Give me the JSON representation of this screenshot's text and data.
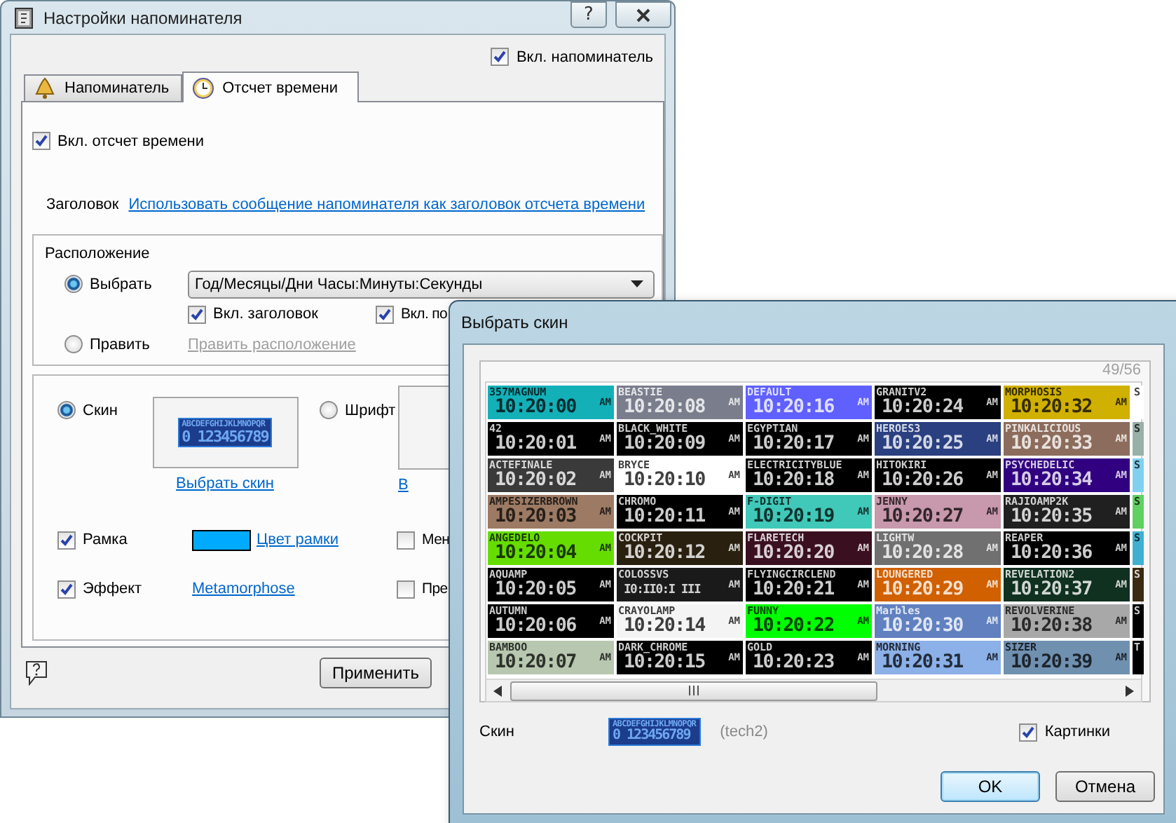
{
  "settings_window": {
    "title": "Настройки напоминателя",
    "help_button": "?",
    "enable_reminder": {
      "label": "Вкл. напоминатель",
      "checked": true
    },
    "tabs": [
      {
        "label": "Напоминатель",
        "selected": false
      },
      {
        "label": "Отсчет времени",
        "selected": true
      }
    ],
    "enable_countdown": {
      "label": "Вкл. отсчет времени",
      "checked": true
    },
    "heading": {
      "label": "Заголовок",
      "link": "Использовать сообщение напоминателя как заголовок отсчета времени"
    },
    "placement": {
      "title": "Расположение",
      "options": [
        {
          "label": "Выбрать",
          "selected": true
        },
        {
          "label": "Править",
          "selected": false
        }
      ],
      "dropdown": "Год/Месяцы/Дни Часы:Минуты:Секунды",
      "checkboxes": [
        {
          "label": "Вкл. заголовок",
          "checked": true
        },
        {
          "label": "Вкл. по",
          "checked": true
        }
      ],
      "edit_link": {
        "label": "Править расположение",
        "disabled": true
      }
    },
    "appearance": {
      "options": [
        {
          "label": "Скин",
          "selected": true
        },
        {
          "label": "Шрифт",
          "selected": false
        }
      ],
      "skin_preview": {
        "letters": "ABCDEFGHIJKLMNOPQR",
        "digits": "0 123456789"
      },
      "choose_skin_link": "Выбрать скин",
      "font_link": "В",
      "frame": {
        "label": "Рамка",
        "checked": true
      },
      "frame_color": {
        "color": "#00aaff",
        "link": "Цвет рамки"
      },
      "effect": {
        "label": "Эффект",
        "checked": true
      },
      "effect_link": "Metamorphose",
      "right_checkboxes": [
        {
          "label": "Мен",
          "checked": false
        },
        {
          "label": "Пре",
          "checked": false
        }
      ]
    },
    "apply_button": "Применить"
  },
  "skin_dialog": {
    "title": "Выбрать скин",
    "counter": "49/56",
    "skins": [
      {
        "kind": "full",
        "name": "357MAGNUM",
        "time": "10:20:00",
        "ampm": "AM",
        "color": "#14b0b8"
      },
      {
        "kind": "full",
        "name": "42",
        "time": "10:20:01",
        "ampm": "AM",
        "color": "#000000"
      },
      {
        "kind": "full",
        "name": "ACTEFINALE",
        "time": "10:20:02",
        "ampm": "AM",
        "color": "#3a3a3a"
      },
      {
        "kind": "full",
        "name": "AMPESIZERBROWN",
        "time": "10:20:03",
        "ampm": "AM",
        "color": "#9c7a64"
      },
      {
        "kind": "full",
        "name": "ANGEDELO",
        "time": "10:20:04",
        "ampm": "AM",
        "color": "#66dd00"
      },
      {
        "kind": "full",
        "name": "AQUAMP",
        "time": "10:20:05",
        "ampm": "AM",
        "color": "#000000"
      },
      {
        "kind": "full",
        "name": "AUTUMN",
        "time": "10:20:06",
        "ampm": "AM",
        "color": "#000000"
      },
      {
        "kind": "full",
        "name": "BAMBOO",
        "time": "10:20:07",
        "ampm": "AM",
        "color": "#b8c8b0"
      },
      {
        "kind": "full",
        "name": "BEASTIE",
        "time": "10:20:08",
        "ampm": "AM",
        "color": "#7a7d8c"
      },
      {
        "kind": "full",
        "name": "BLACK_WHITE",
        "time": "10:20:09",
        "ampm": "AM",
        "color": "#000000"
      },
      {
        "kind": "full",
        "name": "BRYCE",
        "time": "10:20:10",
        "ampm": "AM",
        "color": "#ffffff"
      },
      {
        "kind": "full",
        "name": "CHROMO",
        "time": "10:20:11",
        "ampm": "AM",
        "color": "#000000"
      },
      {
        "kind": "full",
        "name": "COCKPIT",
        "time": "10:20:12",
        "ampm": "AM",
        "color": "#2a2010"
      },
      {
        "kind": "full",
        "name": "COLOSSVS",
        "time": "I0:II0:I III",
        "ampm": "AM",
        "color": "#1a1a1a"
      },
      {
        "kind": "full",
        "name": "CRAYOLAMP",
        "time": "10:20:14",
        "ampm": "AM",
        "color": "#f4f4f4"
      },
      {
        "kind": "full",
        "name": "DARK_CHROME",
        "time": "10:20:15",
        "ampm": "AM",
        "color": "#000000"
      },
      {
        "kind": "full",
        "name": "DEFAULT",
        "time": "10:20:16",
        "ampm": "AM",
        "color": "#6060ff"
      },
      {
        "kind": "full",
        "name": "EGYPTIAN",
        "time": "10:20:17",
        "ampm": "AM",
        "color": "#000000"
      },
      {
        "kind": "full",
        "name": "ELECTRICITYBLUE",
        "time": "10:20:18",
        "ampm": "AM",
        "color": "#000000"
      },
      {
        "kind": "full",
        "name": "F-DIGIT",
        "time": "10:20:19",
        "ampm": "AM",
        "color": "#40c8b8"
      },
      {
        "kind": "full",
        "name": "FLARETECH",
        "time": "10:20:20",
        "ampm": "AM",
        "color": "#3a1020"
      },
      {
        "kind": "full",
        "name": "FLYINGCIRCLEND",
        "time": "10:20:21",
        "ampm": "AM",
        "color": "#000000"
      },
      {
        "kind": "full",
        "name": "FUNNY",
        "time": "10:20:22",
        "ampm": "AM",
        "color": "#00ff00"
      },
      {
        "kind": "full",
        "name": "GOLD",
        "time": "10:20:23",
        "ampm": "AM",
        "color": "#000000"
      },
      {
        "kind": "full",
        "name": "GRANITV2",
        "time": "10:20:24",
        "ampm": "AM",
        "color": "#000000"
      },
      {
        "kind": "full",
        "name": "HEROES3",
        "time": "10:20:25",
        "ampm": "AM",
        "color": "#2a4080"
      },
      {
        "kind": "full",
        "name": "HITOKIRI",
        "time": "10:20:26",
        "ampm": "AM",
        "color": "#000000"
      },
      {
        "kind": "full",
        "name": "JENNY",
        "time": "10:20:27",
        "ampm": "AM",
        "color": "#c898ac"
      },
      {
        "kind": "full",
        "name": "LIGHTW",
        "time": "10:20:28",
        "ampm": "AM",
        "color": "#707070"
      },
      {
        "kind": "full",
        "name": "LOUNGERED",
        "time": "10:20:29",
        "ampm": "AM",
        "color": "#d06000"
      },
      {
        "kind": "full",
        "name": "Marbles",
        "time": "10:20:30",
        "ampm": "AM",
        "color": "#6080c0"
      },
      {
        "kind": "full",
        "name": "MORNING",
        "time": "10:20:31",
        "ampm": "AM",
        "color": "#8cb0e8"
      },
      {
        "kind": "full",
        "name": "MORPHOSIS",
        "time": "10:20:32",
        "ampm": "AM",
        "color": "#d0b000"
      },
      {
        "kind": "full",
        "name": "PINKALICIOUS",
        "time": "10:20:33",
        "ampm": "AM",
        "color": "#8c6c5c"
      },
      {
        "kind": "full",
        "name": "PSYCHEDELIC",
        "time": "10:20:34",
        "ampm": "AM",
        "color": "#300080"
      },
      {
        "kind": "full",
        "name": "RAJIOAMP2K",
        "time": "10:20:35",
        "ampm": "AM",
        "color": "#202020"
      },
      {
        "kind": "full",
        "name": "REAPER",
        "time": "10:20:36",
        "ampm": "AM",
        "color": "#000000"
      },
      {
        "kind": "full",
        "name": "REVELATION2",
        "time": "10:20:37",
        "ampm": "AM",
        "color": "#103020"
      },
      {
        "kind": "full",
        "name": "REVOLVERINE",
        "time": "10:20:38",
        "ampm": "AM",
        "color": "#a8a8a8"
      },
      {
        "kind": "full",
        "name": "SIZER",
        "time": "10:20:39",
        "ampm": "AM",
        "color": "#7090b0"
      },
      {
        "kind": "cut",
        "name": "S",
        "color": "#ffffff"
      },
      {
        "kind": "cut",
        "name": "S",
        "color": "#98b0a8"
      },
      {
        "kind": "cut",
        "name": "S",
        "color": "#80d0f0"
      },
      {
        "kind": "cut",
        "name": "S",
        "color": "#60d060"
      },
      {
        "kind": "cut",
        "name": "S",
        "color": "#40b0d0"
      },
      {
        "kind": "cut",
        "name": "S",
        "color": "#3a2a10"
      },
      {
        "kind": "cut",
        "name": "S",
        "color": "#000000"
      },
      {
        "kind": "cut",
        "name": "T",
        "color": "#000000"
      }
    ],
    "skin_label": "Скин",
    "preview": {
      "letters": "ABCDEFGHIJKLMNOPQR",
      "digits": "0 123456789"
    },
    "skin_name": "(tech2)",
    "pictures": {
      "label": "Картинки",
      "checked": true
    },
    "buttons": [
      {
        "label": "OK",
        "default": true
      },
      {
        "label": "Отмена",
        "default": false
      }
    ]
  }
}
